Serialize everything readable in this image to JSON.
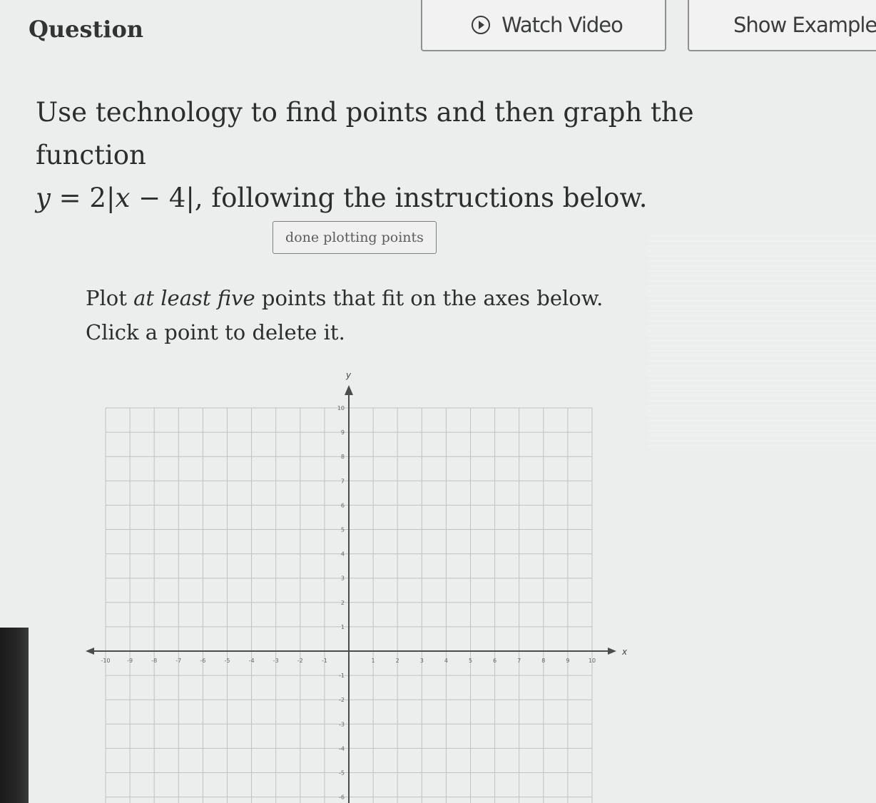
{
  "header": {
    "question_label": "Question",
    "watch_video_label": "Watch Video",
    "show_examples_label": "Show Example"
  },
  "prompt": {
    "line1": "Use technology to find points and then graph the function",
    "math_y": "y",
    "math_eq": "= 2|",
    "math_x": "x",
    "math_rest": "− 4|",
    "line2_suffix": ", following the instructions below."
  },
  "done_button_label": "done plotting points",
  "instructions": {
    "part1": "Plot ",
    "em1": "at least five",
    "part2": " points that fit on the axes below. Click a point to delete it."
  },
  "graph": {
    "x_axis_label": "x",
    "y_axis_label": "y",
    "x_range": [
      -10,
      10
    ],
    "y_range": [
      -6,
      10
    ],
    "x_tick_labels": [
      "-10",
      "-9",
      "-8",
      "-7",
      "-6",
      "-5",
      "-4",
      "-3",
      "-2",
      "-1",
      "1",
      "2",
      "3",
      "4",
      "5",
      "6",
      "7",
      "8",
      "9",
      "10"
    ],
    "x_tick_values": [
      -10,
      -9,
      -8,
      -7,
      -6,
      -5,
      -4,
      -3,
      -2,
      -1,
      1,
      2,
      3,
      4,
      5,
      6,
      7,
      8,
      9,
      10
    ],
    "y_tick_labels": [
      "10",
      "9",
      "8",
      "7",
      "6",
      "5",
      "4",
      "3",
      "2",
      "1",
      "-1",
      "-2",
      "-3",
      "-4",
      "-5",
      "-6"
    ],
    "y_tick_values": [
      10,
      9,
      8,
      7,
      6,
      5,
      4,
      3,
      2,
      1,
      -1,
      -2,
      -3,
      -4,
      -5,
      -6
    ],
    "grid": true,
    "plotted_points": []
  }
}
